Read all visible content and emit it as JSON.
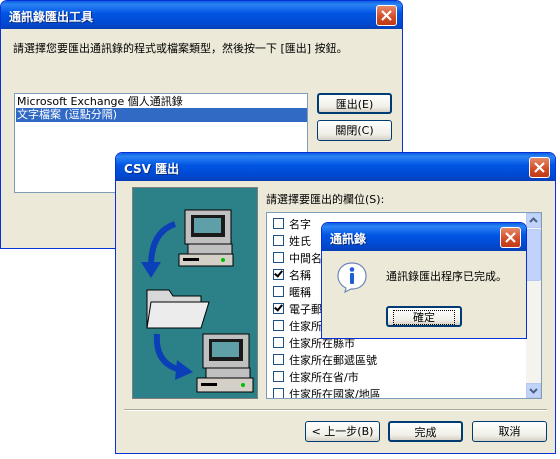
{
  "export_tool": {
    "title": "通訊錄匯出工具",
    "prompt": "請選擇您要匯出通訊錄的程式或檔案類型，然後按一下 [匯出] 按鈕。",
    "options": [
      "Microsoft Exchange 個人通訊錄",
      "文字檔案 (逗點分隔)"
    ],
    "selected_index": 1,
    "export_button": "匯出(E)",
    "close_button": "關閉(C)"
  },
  "csv_export": {
    "title": "CSV 匯出",
    "fields_label": "請選擇要匯出的欄位(S):",
    "fields": [
      {
        "label": "名字",
        "checked": false
      },
      {
        "label": "姓氏",
        "checked": false
      },
      {
        "label": "中間名",
        "checked": false
      },
      {
        "label": "名稱",
        "checked": true
      },
      {
        "label": "暱稱",
        "checked": false
      },
      {
        "label": "電子郵件地址",
        "checked": true
      },
      {
        "label": "住家所在街道",
        "checked": false
      },
      {
        "label": "住家所在縣市",
        "checked": false
      },
      {
        "label": "住家所在郵遞區號",
        "checked": false
      },
      {
        "label": "住家所在省/市",
        "checked": false
      },
      {
        "label": "住家所在國家/地區",
        "checked": false
      }
    ],
    "back_button": "< 上一步(B)",
    "finish_button": "完成",
    "cancel_button": "取消"
  },
  "message_box": {
    "title": "通訊錄",
    "message": "通訊錄匯出程序已完成。",
    "ok_button": "確定",
    "icon": "info-icon"
  },
  "colors": {
    "title_blue": "#0054e3",
    "dialog_bg": "#ece9d8",
    "selection": "#316ac5",
    "illustration_teal": "#2c8088"
  }
}
